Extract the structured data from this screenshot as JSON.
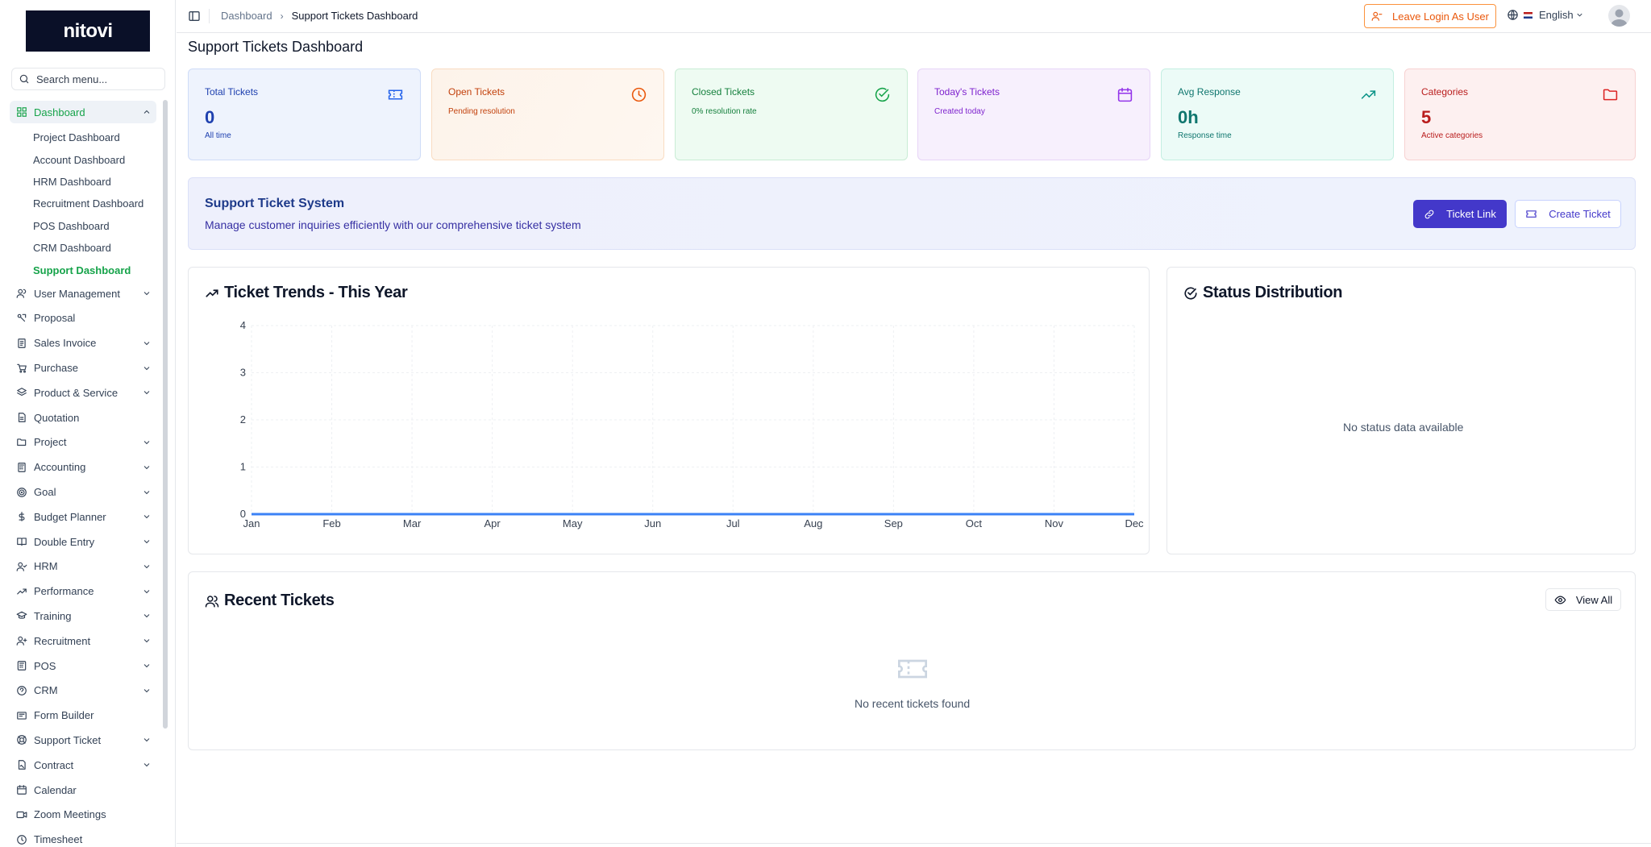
{
  "brand": "nitovi",
  "search": {
    "placeholder": "Search menu..."
  },
  "nav": {
    "dashboard": "Dashboard",
    "sub": [
      "Project Dashboard",
      "Account Dashboard",
      "HRM Dashboard",
      "Recruitment Dashboard",
      "POS Dashboard",
      "CRM Dashboard",
      "Support Dashboard"
    ],
    "items": [
      "User Management",
      "Proposal",
      "Sales Invoice",
      "Purchase",
      "Product & Service",
      "Quotation",
      "Project",
      "Accounting",
      "Goal",
      "Budget Planner",
      "Double Entry",
      "HRM",
      "Performance",
      "Training",
      "Recruitment",
      "POS",
      "CRM",
      "Form Builder",
      "Support Ticket",
      "Contract",
      "Calendar",
      "Zoom Meetings",
      "Timesheet"
    ]
  },
  "topbar": {
    "breadcrumb": [
      "Dashboard",
      "Support Tickets Dashboard"
    ],
    "leave_label": "Leave Login As User",
    "language": "English"
  },
  "page_title": "Support Tickets Dashboard",
  "stats": [
    {
      "title": "Total Tickets",
      "value": "0",
      "sub": "All time",
      "color": "#1e40af"
    },
    {
      "title": "Open Tickets",
      "sub": "Pending resolution",
      "color": "#c2410c"
    },
    {
      "title": "Closed Tickets",
      "sub": "0% resolution rate",
      "color": "#15803d"
    },
    {
      "title": "Today's Tickets",
      "sub": "Created today",
      "color": "#7e22ce"
    },
    {
      "title": "Avg Response",
      "value": "0h",
      "sub": "Response time",
      "color": "#0f766e"
    },
    {
      "title": "Categories",
      "value": "5",
      "sub": "Active categories",
      "color": "#b91c1c"
    }
  ],
  "banner": {
    "title": "Support Ticket System",
    "subtitle": "Manage customer inquiries efficiently with our comprehensive ticket system",
    "ticket_link": "Ticket Link",
    "create_ticket": "Create Ticket"
  },
  "trends_title": "Ticket Trends - This Year",
  "status_title": "Status Distribution",
  "status_empty": "No status data available",
  "recent_title": "Recent Tickets",
  "recent_empty": "No recent tickets found",
  "view_all": "View All",
  "chart_data": {
    "type": "line",
    "title": "Ticket Trends - This Year",
    "categories": [
      "Jan",
      "Feb",
      "Mar",
      "Apr",
      "May",
      "Jun",
      "Jul",
      "Aug",
      "Sep",
      "Oct",
      "Nov",
      "Dec"
    ],
    "series": [
      {
        "values": [
          0,
          0,
          0,
          0,
          0,
          0,
          0,
          0,
          0,
          0,
          0,
          0
        ],
        "color": "#3b82f6"
      }
    ],
    "yticks": [
      0,
      1,
      2,
      3,
      4
    ],
    "ylim": [
      0,
      4
    ],
    "grid": true
  }
}
